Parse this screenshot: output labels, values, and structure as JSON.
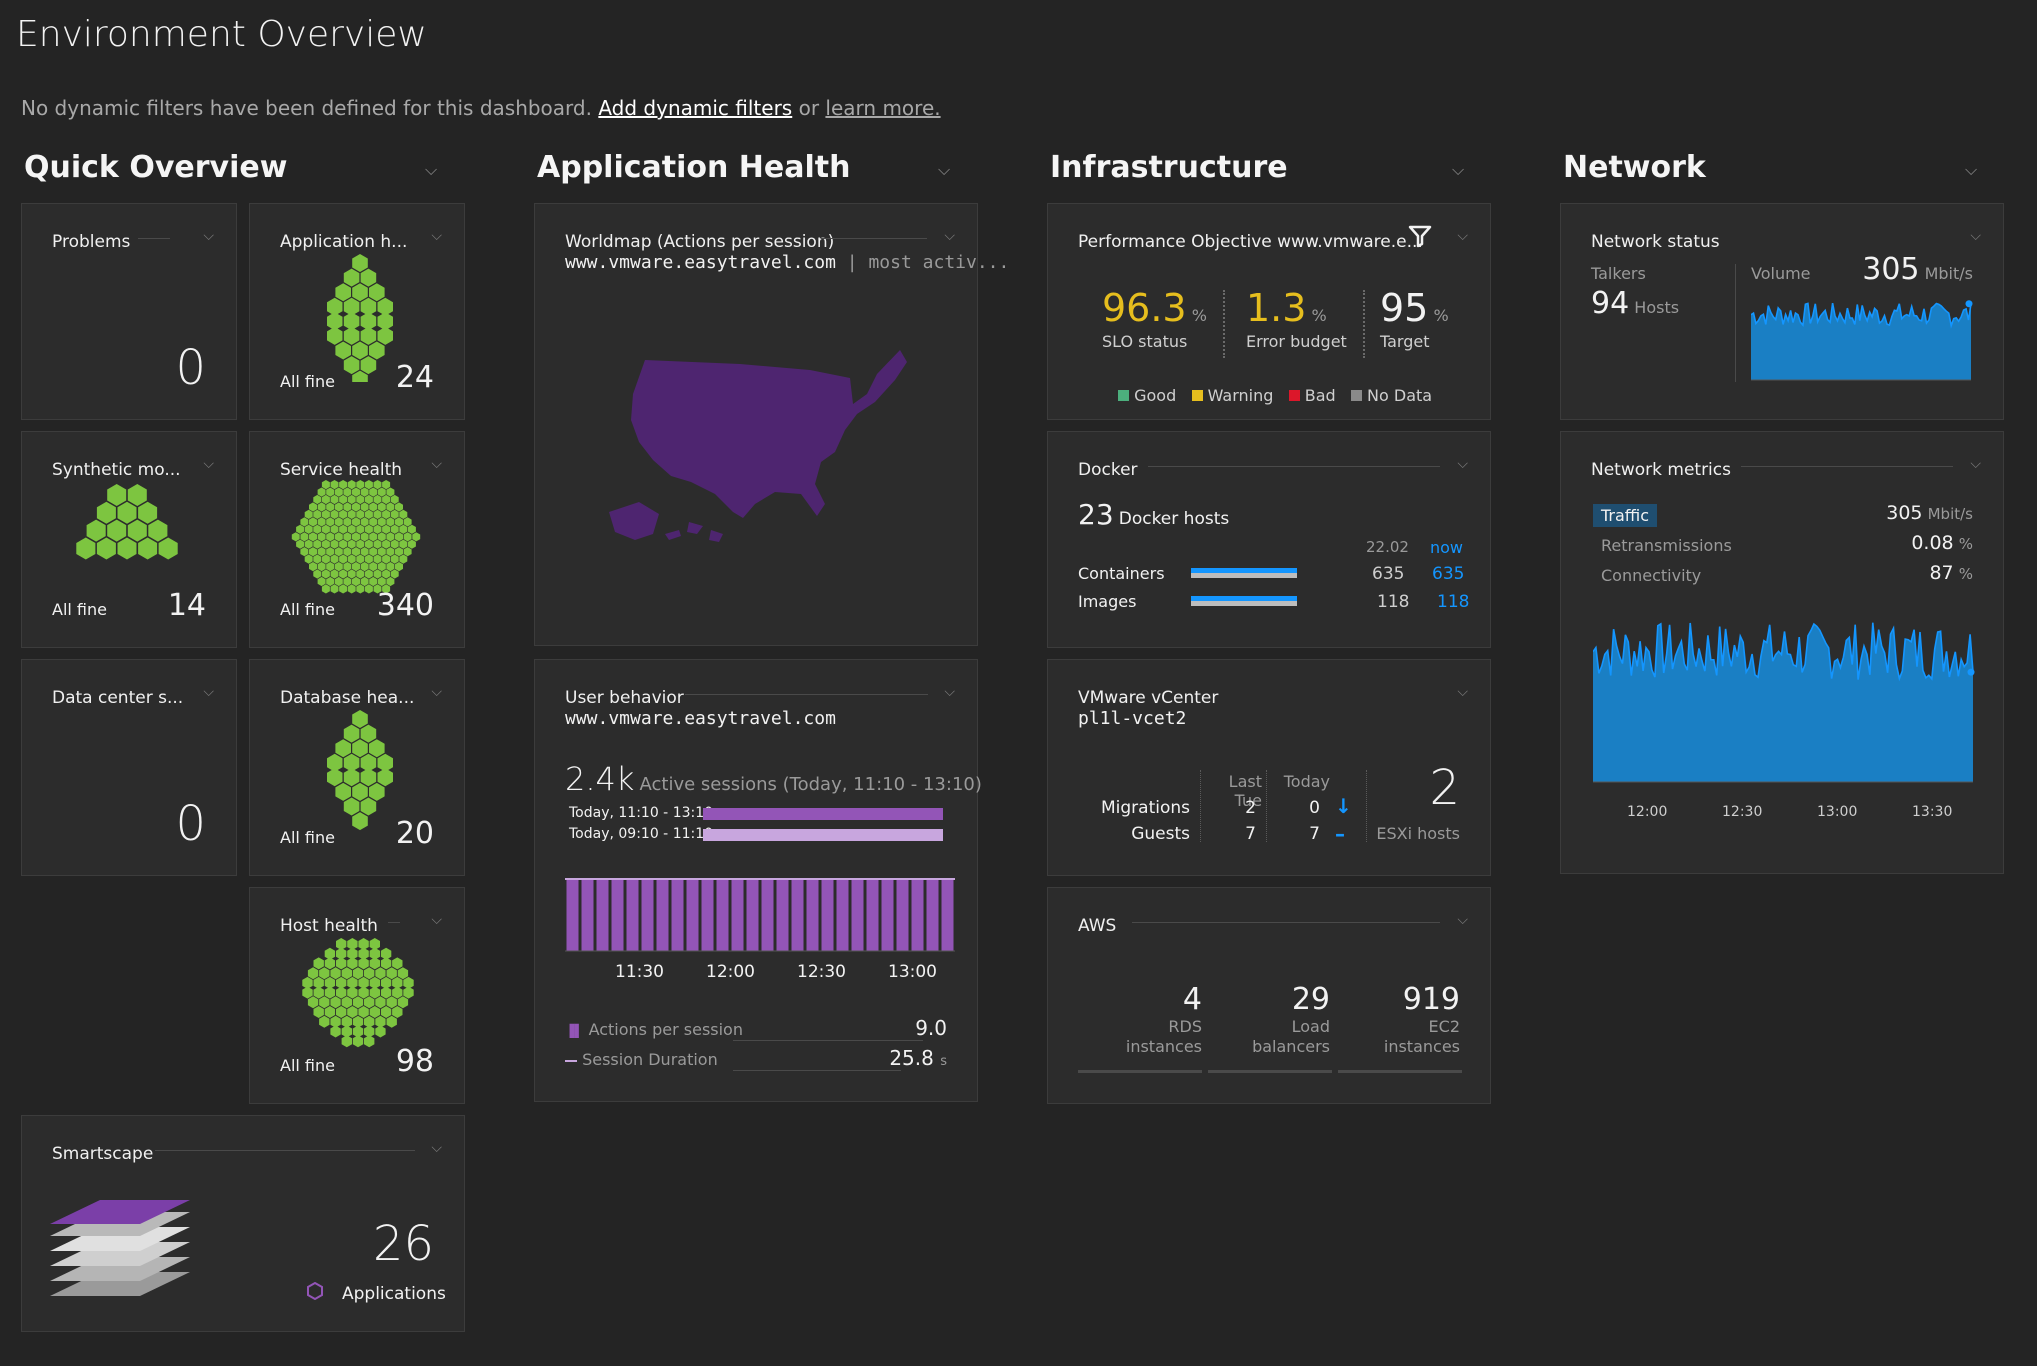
{
  "page": {
    "title": "Environment Overview"
  },
  "filters": {
    "text": "No dynamic filters have been defined for this dashboard.",
    "add_link": "Add dynamic filters",
    "or": "or",
    "learn_link": "learn more."
  },
  "sections": {
    "quick": "Quick Overview",
    "app": "Application Health",
    "infra": "Infrastructure",
    "network": "Network"
  },
  "problems": {
    "title": "Problems",
    "value": "0"
  },
  "app_health": {
    "title": "Application h...",
    "status": "All fine",
    "count": "24"
  },
  "synthetic": {
    "title": "Synthetic mo...",
    "status": "All fine",
    "count": "14"
  },
  "service_health": {
    "title": "Service health",
    "status": "All fine",
    "count": "340"
  },
  "datacenter": {
    "title": "Data center s...",
    "value": "0"
  },
  "db_health": {
    "title": "Database hea...",
    "status": "All fine",
    "count": "20"
  },
  "host_health": {
    "title": "Host health",
    "status": "All fine",
    "count": "98"
  },
  "smartscape": {
    "title": "Smartscape",
    "count": "26",
    "label": "Applications"
  },
  "worldmap": {
    "title": "Worldmap (Actions per session)",
    "domain": "www.vmware.easytravel.com",
    "sep": "|",
    "suffix": "most activ..."
  },
  "user_behavior": {
    "title": "User behavior",
    "domain": "www.vmware.easytravel.com",
    "active_value": "2.4k",
    "active_label": "Active sessions (Today, 11:10 - 13:10)",
    "bar1_label": "Today, 11:10 - 13:10",
    "bar2_label": "Today, 09:10 - 11:10",
    "bar1_fraction": 1.0,
    "bar2_fraction": 1.0,
    "x_labels": [
      "11:30",
      "12:00",
      "12:30",
      "13:00"
    ],
    "aps_label": "Actions per session",
    "aps_value": "9.0",
    "sd_label": "Session Duration",
    "sd_value": "25.8",
    "sd_unit": "s"
  },
  "slo": {
    "title": "Performance Objective www.vmware.e...",
    "status_value": "96.3",
    "status_label": "SLO status",
    "pct": "%",
    "budget_value": "1.3",
    "budget_label": "Error budget",
    "target_value": "95",
    "target_label": "Target",
    "legend": [
      "Good",
      "Warning",
      "Bad",
      "No Data"
    ],
    "legend_colors": [
      "#4caf7d",
      "#e6be1e",
      "#dc172a",
      "#8a8a8a"
    ],
    "accent": "#e6be1e"
  },
  "docker": {
    "title": "Docker",
    "hosts_value": "23",
    "hosts_label": "Docker hosts",
    "col1": "22.02",
    "col2": "now",
    "rows": [
      {
        "label": "Containers",
        "v1": "635",
        "v2": "635"
      },
      {
        "label": "Images",
        "v1": "118",
        "v2": "118"
      }
    ]
  },
  "vcenter": {
    "title": "VMware vCenter",
    "name": "pl1l-vcet2",
    "col1": "Last Tue",
    "col2": "Today",
    "rows": [
      {
        "label": "Migrations",
        "v1": "2",
        "v2": "0",
        "sym": "↓"
      },
      {
        "label": "Guests",
        "v1": "7",
        "v2": "7",
        "sym": "–"
      }
    ],
    "esxi_value": "2",
    "esxi_label": "ESXi hosts"
  },
  "aws": {
    "title": "AWS",
    "items": [
      {
        "value": "4",
        "l1": "RDS",
        "l2": "instances"
      },
      {
        "value": "29",
        "l1": "Load",
        "l2": "balancers"
      },
      {
        "value": "919",
        "l1": "EC2",
        "l2": "instances"
      }
    ]
  },
  "net_status": {
    "title": "Network status",
    "talkers_label": "Talkers",
    "talkers_value": "94",
    "talkers_unit": "Hosts",
    "volume_label": "Volume",
    "volume_value": "305",
    "volume_unit": "Mbit/s"
  },
  "net_metrics": {
    "title": "Network metrics",
    "rows": [
      {
        "label": "Traffic",
        "value": "305",
        "unit": "Mbit/s"
      },
      {
        "label": "Retransmissions",
        "value": "0.08",
        "unit": "%"
      },
      {
        "label": "Connectivity",
        "value": "87",
        "unit": "%"
      }
    ],
    "x_labels": [
      "12:00",
      "12:30",
      "13:00",
      "13:30"
    ]
  },
  "colors": {
    "hex_green": "#7dc540",
    "chart_blue": "#1496ff",
    "area_blue": "#1a7fc4",
    "purple": "#9355b7",
    "map_purple": "#4e2570"
  },
  "icons": {
    "chevron": "chevron-down-icon",
    "filter": "filter-icon",
    "hexagon": "hexagon-outline-icon",
    "layers": "smartscape-layers-icon"
  }
}
